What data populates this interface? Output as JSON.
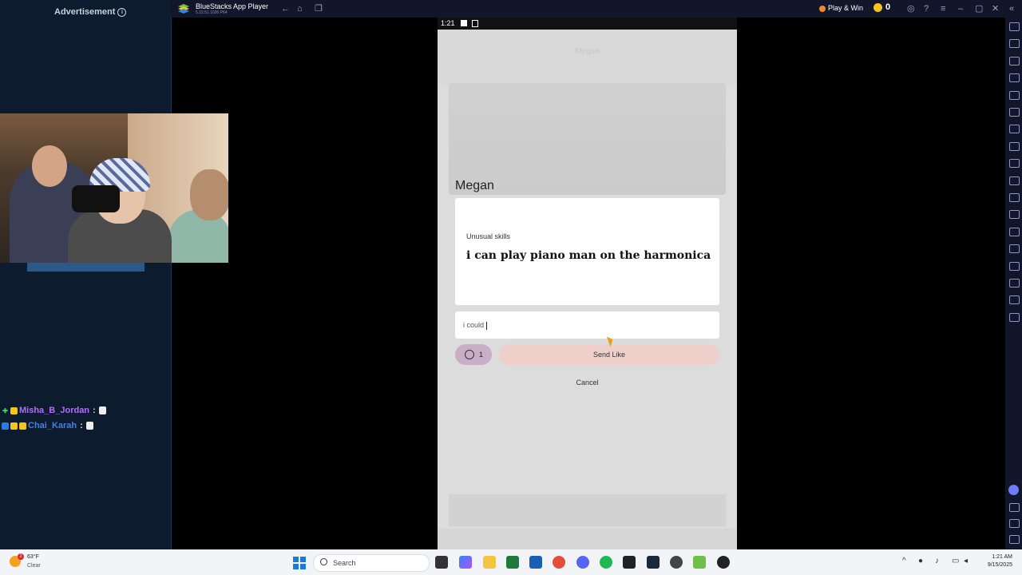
{
  "stream": {
    "ad_label": "Advertisement",
    "info_glyph": "i",
    "chat": [
      {
        "user": "Misha_B_Jordan",
        "color": "#b56cff"
      },
      {
        "user": "Chai_Karah",
        "color": "#4a7fe0"
      }
    ]
  },
  "bluestacks": {
    "title": "BlueStacks App Player",
    "version": "5.22.51.1036 P64",
    "play_win": "Play & Win",
    "coins": "0"
  },
  "phone": {
    "status_time": "1:21",
    "header_name_dim": "Megan",
    "match_name": "Megan",
    "prompt_question": "Unusual skills",
    "prompt_answer": "i can play piano man on the harmonica",
    "comment_value": "i could",
    "rose_count": "1",
    "send_like_label": "Send Like",
    "cancel_label": "Cancel"
  },
  "taskbar": {
    "weather_temp": "63°F",
    "weather_condition": "Clear",
    "weather_alert": "2",
    "search_placeholder": "Search",
    "time": "1:21 AM",
    "date": "9/15/2025"
  },
  "colors": {
    "accent_send_like": "#efcfc9",
    "rose_button": "#c9aec7",
    "titlebar": "#11162b"
  }
}
